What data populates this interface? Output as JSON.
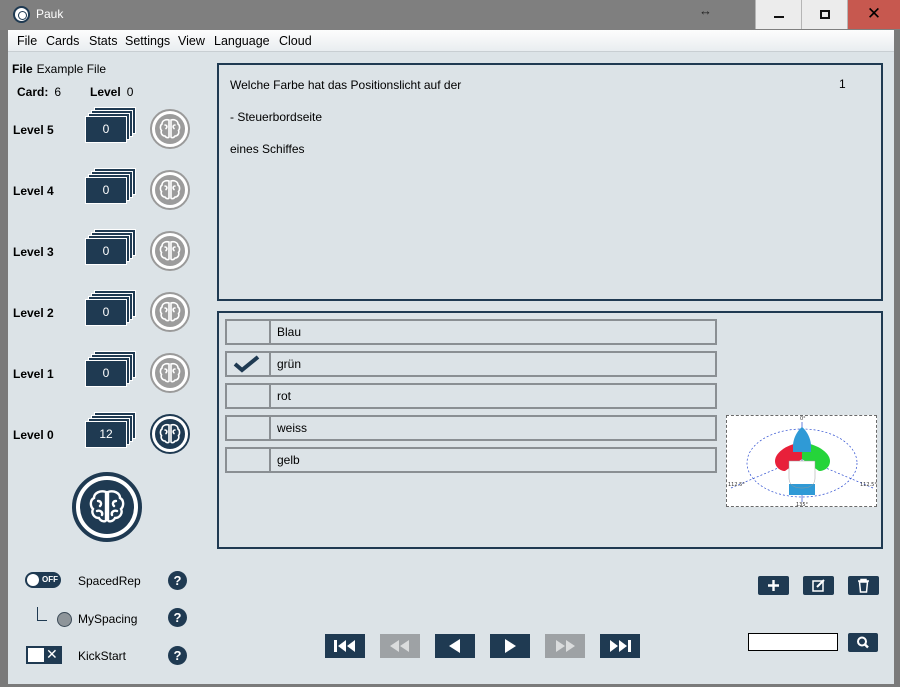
{
  "window": {
    "title": "Pauk",
    "resize_glyph": "↔",
    "close_glyph": "✕"
  },
  "menu": [
    "File",
    "Cards",
    "Stats",
    "Settings",
    "View",
    "Language",
    "Cloud"
  ],
  "file": {
    "label": "File",
    "name": "Example File"
  },
  "card": {
    "label": "Card:",
    "value": "6"
  },
  "level": {
    "label": "Level",
    "value": "0"
  },
  "levels": [
    {
      "label": "Level 5",
      "count": "0"
    },
    {
      "label": "Level 4",
      "count": "0"
    },
    {
      "label": "Level 3",
      "count": "0"
    },
    {
      "label": "Level 2",
      "count": "0"
    },
    {
      "label": "Level 1",
      "count": "0"
    },
    {
      "label": "Level 0",
      "count": "12"
    }
  ],
  "options": {
    "spacedrep": {
      "toggle_text": "OFF",
      "label": "SpacedRep"
    },
    "myspacing": {
      "label": "MySpacing"
    },
    "kickstart": {
      "label": "KickStart",
      "glyph": "✕"
    },
    "help_glyph": "?"
  },
  "question": {
    "lines": [
      "Welche Farbe hat das Positionslicht auf der",
      "- Steuerbordseite",
      "eines Schiffes"
    ],
    "number": "1"
  },
  "answers": [
    {
      "text": "Blau",
      "checked": false
    },
    {
      "text": "grün",
      "checked": true
    },
    {
      "text": "rot",
      "checked": false
    },
    {
      "text": "weiss",
      "checked": false
    },
    {
      "text": "gelb",
      "checked": false
    }
  ],
  "diagram": {
    "top": "0°",
    "left": "112.5°",
    "right": "112.5°",
    "bottom": "135°"
  },
  "search": {
    "value": ""
  },
  "colors": {
    "accent": "#1f3a52",
    "disabled": "#9ea2a5",
    "background": "#dce3e7",
    "red": "#e8203a",
    "green": "#25d43a",
    "blue": "#2f9ad6"
  },
  "icons": [
    "brain-icon",
    "plus-icon",
    "edit-icon",
    "trash-icon",
    "search-icon",
    "first-icon",
    "rewind-icon",
    "previous-icon",
    "next-icon",
    "fast-forward-icon",
    "last-icon",
    "check-icon"
  ]
}
